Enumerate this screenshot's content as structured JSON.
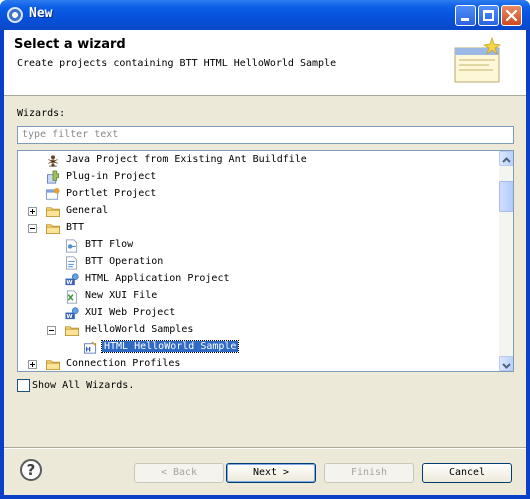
{
  "window": {
    "title": "New"
  },
  "header": {
    "title": "Select a wizard",
    "description": "Create projects containing BTT HTML HelloWorld Sample"
  },
  "wizards": {
    "label": "Wizards:",
    "filter_placeholder": "type filter text",
    "tree": [
      {
        "label": "Java Project from Existing Ant Buildfile",
        "icon": "ant-icon",
        "indent": 1,
        "expander": null
      },
      {
        "label": "Plug-in Project",
        "icon": "plugin-project-icon",
        "indent": 1,
        "expander": null
      },
      {
        "label": "Portlet Project",
        "icon": "portlet-project-icon",
        "indent": 1,
        "expander": null
      },
      {
        "label": "General",
        "icon": "folder-icon",
        "indent": 1,
        "expander": "collapsed"
      },
      {
        "label": "BTT",
        "icon": "folder-icon",
        "indent": 1,
        "expander": "expanded"
      },
      {
        "label": "BTT Flow",
        "icon": "btt-flow-icon",
        "indent": 2,
        "expander": null
      },
      {
        "label": "BTT Operation",
        "icon": "btt-operation-icon",
        "indent": 2,
        "expander": null
      },
      {
        "label": "HTML Application Project",
        "icon": "web-project-icon",
        "indent": 2,
        "expander": null
      },
      {
        "label": "New XUI File",
        "icon": "xui-file-icon",
        "indent": 2,
        "expander": null
      },
      {
        "label": "XUI Web Project",
        "icon": "web-project-icon",
        "indent": 2,
        "expander": null
      },
      {
        "label": "HelloWorld Samples",
        "icon": "folder-icon",
        "indent": 2,
        "expander": "expanded"
      },
      {
        "label": "HTML HelloWorld Sample",
        "icon": "html-sample-icon",
        "indent": 3,
        "expander": null,
        "selected": true
      },
      {
        "label": "Connection Profiles",
        "icon": "folder-icon",
        "indent": 1,
        "expander": "collapsed"
      }
    ]
  },
  "show_all": {
    "label": "Show All Wizards.",
    "checked": false
  },
  "buttons": {
    "back": "< Back",
    "next": "Next >",
    "finish": "Finish",
    "cancel": "Cancel"
  },
  "colors": {
    "titlebar": "#0651db",
    "selection": "#316ac5",
    "dialog": "#ece9d8"
  }
}
